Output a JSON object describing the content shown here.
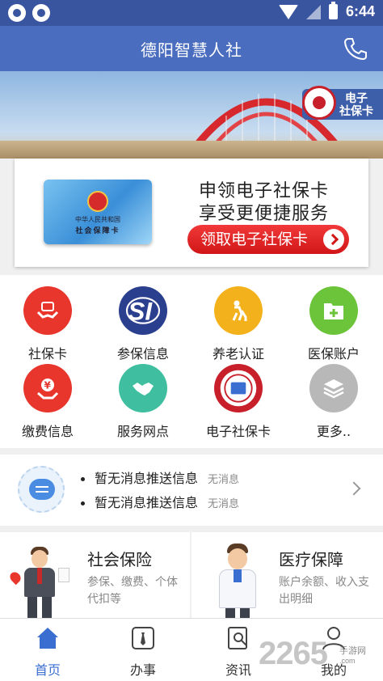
{
  "status_bar": {
    "time": "6:44"
  },
  "header": {
    "title": "德阳智慧人社"
  },
  "banner": {
    "badge_line1": "电子",
    "badge_line2": "社保卡"
  },
  "promo": {
    "card_caption_line1": "中华人民共和国",
    "card_caption_line2": "社会保障卡",
    "line1": "申领电子社保卡",
    "line2": "享受更便捷服务",
    "button_label": "领取电子社保卡"
  },
  "grid": {
    "items": [
      {
        "label": "社保卡",
        "icon": "hands-card-icon",
        "color": "#e8362d"
      },
      {
        "label": "参保信息",
        "icon": "si-logo-icon",
        "color": "#2b3f8f"
      },
      {
        "label": "养老认证",
        "icon": "elderly-person-icon",
        "color": "#f3b21c"
      },
      {
        "label": "医保账户",
        "icon": "medical-folder-icon",
        "color": "#6cc43a"
      },
      {
        "label": "缴费信息",
        "icon": "yuan-hand-icon",
        "color": "#e8362d"
      },
      {
        "label": "服务网点",
        "icon": "handshake-icon",
        "color": "#3fbf9f"
      },
      {
        "label": "电子社保卡",
        "icon": "social-security-card-icon",
        "color": "#c8202a"
      },
      {
        "label": "更多..",
        "icon": "layers-icon",
        "color": "#b8b8b8"
      }
    ]
  },
  "news": {
    "items": [
      {
        "text": "暂无消息推送信息",
        "tag": "无消息"
      },
      {
        "text": "暂无消息推送信息",
        "tag": "无消息"
      }
    ]
  },
  "services": [
    {
      "title": "社会保险",
      "desc": "参保、缴费、个体代扣等"
    },
    {
      "title": "医疗保障",
      "desc": "账户余额、收入支出明细"
    }
  ],
  "bottom_nav": {
    "items": [
      {
        "label": "首页",
        "icon": "home-icon",
        "active": true
      },
      {
        "label": "办事",
        "icon": "tie-card-icon",
        "active": false
      },
      {
        "label": "资讯",
        "icon": "search-doc-icon",
        "active": false
      },
      {
        "label": "我的",
        "icon": "user-icon",
        "active": false
      }
    ]
  },
  "watermark": {
    "text": "2265",
    "sub1": "手游网",
    "sub2": ".com"
  },
  "colors": {
    "header": "#4a6dbf",
    "accent_red": "#d01616",
    "active_nav": "#3a6fd1"
  }
}
